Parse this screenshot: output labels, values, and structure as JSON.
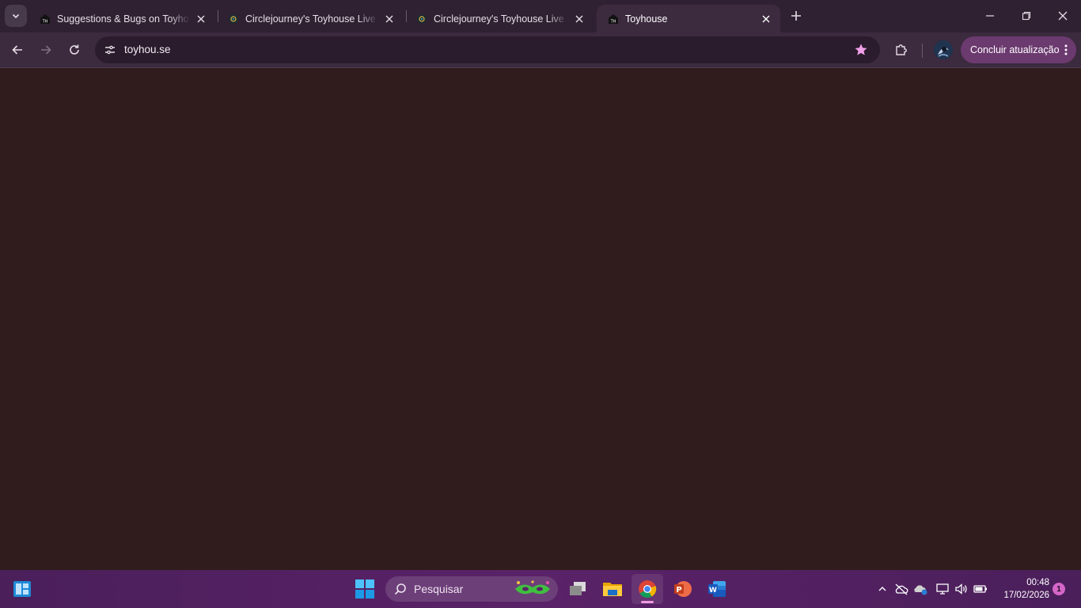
{
  "browser": {
    "tabs": [
      {
        "title": "Suggestions & Bugs on Toyhouse",
        "favicon": "toyhouse-favicon",
        "active": false
      },
      {
        "title": "Circlejourney's Toyhouse Live Code Editor",
        "favicon": "circlejourney-favicon",
        "active": false
      },
      {
        "title": "Circlejourney's Toyhouse Live Code Editor",
        "favicon": "circlejourney-favicon",
        "active": false
      },
      {
        "title": "Toyhouse",
        "favicon": "toyhouse-favicon",
        "active": true
      }
    ],
    "favicon_text": "TH",
    "address": "toyhou.se",
    "update_label": "Concluir atualização",
    "colors": {
      "tabstrip": "#2f2132",
      "toolbar": "#3c2a3e",
      "omnibox": "#2a1c2c",
      "update_button": "#6b3a6f",
      "page_background": "#301c1c",
      "bookmark_star": "#f0a0e8"
    }
  },
  "taskbar": {
    "search_placeholder": "Pesquisar",
    "apps": [
      "task-view",
      "file-explorer",
      "chrome",
      "powerpoint",
      "word"
    ],
    "active_app": "chrome",
    "time": "00:48",
    "date": "17/02/2026",
    "notification_count": "1"
  }
}
